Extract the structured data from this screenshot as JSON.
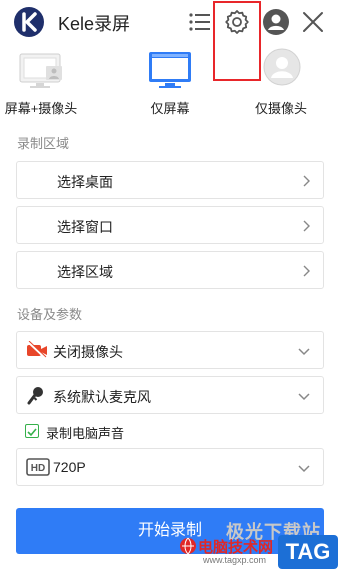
{
  "app": {
    "title": "Kele录屏"
  },
  "modes": [
    {
      "label": "屏幕+摄像头",
      "icon": "screen-camera-icon"
    },
    {
      "label": "仅屏幕",
      "icon": "screen-icon",
      "selected": true
    },
    {
      "label": "仅摄像头",
      "icon": "camera-person-icon"
    }
  ],
  "record_area": {
    "title": "录制区域",
    "items": [
      {
        "label": "选择桌面"
      },
      {
        "label": "选择窗口"
      },
      {
        "label": "选择区域"
      }
    ]
  },
  "devices": {
    "title": "设备及参数",
    "camera": "关闭摄像头",
    "microphone": "系统默认麦克风",
    "record_pc_audio": {
      "label": "录制电脑声音",
      "checked": true
    },
    "quality": {
      "badge": "HD",
      "value": "720P"
    }
  },
  "start_button": "开始录制",
  "watermark": {
    "line1": "极光下载站",
    "line2": "电脑技术网",
    "line3": "www.tagxp.com",
    "tag": "TAG"
  },
  "colors": {
    "accent": "#2f7cf6",
    "highlight": "#e8262a",
    "camera_off": "#e8462a",
    "checkbox": "#35b04a"
  }
}
